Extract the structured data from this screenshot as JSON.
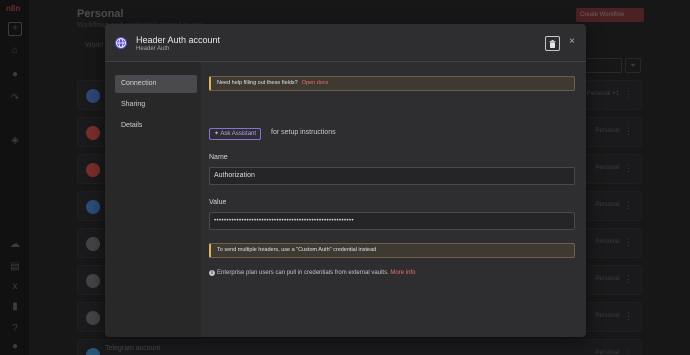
{
  "background": {
    "page_title": "Personal",
    "page_subtitle": "Workflows and credentials owned by you",
    "create_button": "Create Workflow",
    "tab": "Workf",
    "rows": [
      {
        "title": "",
        "owner": "Personal",
        "extra": "+1",
        "icon_color": "#5a7bd8"
      },
      {
        "title": "",
        "owner": "Personal",
        "extra": "",
        "icon_color": "#d9534f"
      },
      {
        "title": "",
        "owner": "Personal",
        "extra": "",
        "icon_color": "#d9534f"
      },
      {
        "title": "",
        "owner": "Personal",
        "extra": "",
        "icon_color": "#4d8ad9"
      },
      {
        "title": "",
        "owner": "Personal",
        "extra": "",
        "icon_color": "#7a7a7e"
      },
      {
        "title": "",
        "owner": "Personal",
        "extra": "",
        "icon_color": "#7a7a7e"
      },
      {
        "title": "",
        "owner": "Personal",
        "extra": "",
        "icon_color": "#7a7a7e"
      },
      {
        "title": "Telegram account",
        "owner": "Personal",
        "extra": "",
        "icon_color": "#4a9ad6"
      }
    ]
  },
  "modal": {
    "title": "Header Auth account",
    "subtitle": "Header Auth",
    "trash_icon": "trash-icon",
    "close_label": "×",
    "sidebar": [
      {
        "label": "Connection",
        "active": true
      },
      {
        "label": "Sharing",
        "active": false
      },
      {
        "label": "Details",
        "active": false
      }
    ],
    "help_notice": {
      "text": "Need help filling out these fields?",
      "link": "Open docs"
    },
    "assistant": {
      "button": "✦ Ask Assistant",
      "after": "for setup instructions"
    },
    "name": {
      "label": "Name",
      "value": "Authorization"
    },
    "value": {
      "label": "Value",
      "value": "••••••••••••••••••••••••••••••••••••••••••••••••••••••••"
    },
    "headers_notice": "To send multiple headers, use a \"Custom Auth\" credential instead",
    "enterprise": {
      "text": "Enterprise plan users can pull in credentials from external vaults.",
      "link": "More info"
    }
  },
  "colors": {
    "accent_red": "#ea6f6f",
    "assistant_purple": "#8b6fd6",
    "notice_border": "#d9b25a"
  }
}
